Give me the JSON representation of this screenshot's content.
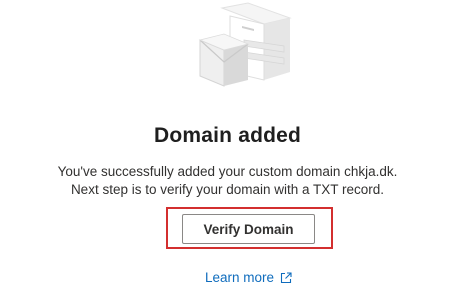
{
  "illustration": {
    "icon": "domain-envelope-illustration-icon"
  },
  "main": {
    "title": "Domain added",
    "description_line1": "You've successfully added your custom domain chkja.dk.",
    "description_line2": "Next step is to verify your domain with a TXT record."
  },
  "actions": {
    "verify_label": "Verify Domain",
    "learn_more_label": "Learn more",
    "learn_more_icon": "external-link-icon"
  },
  "colors": {
    "link": "#0f6cbd",
    "highlight": "#d32f2f",
    "text": "#323130"
  }
}
